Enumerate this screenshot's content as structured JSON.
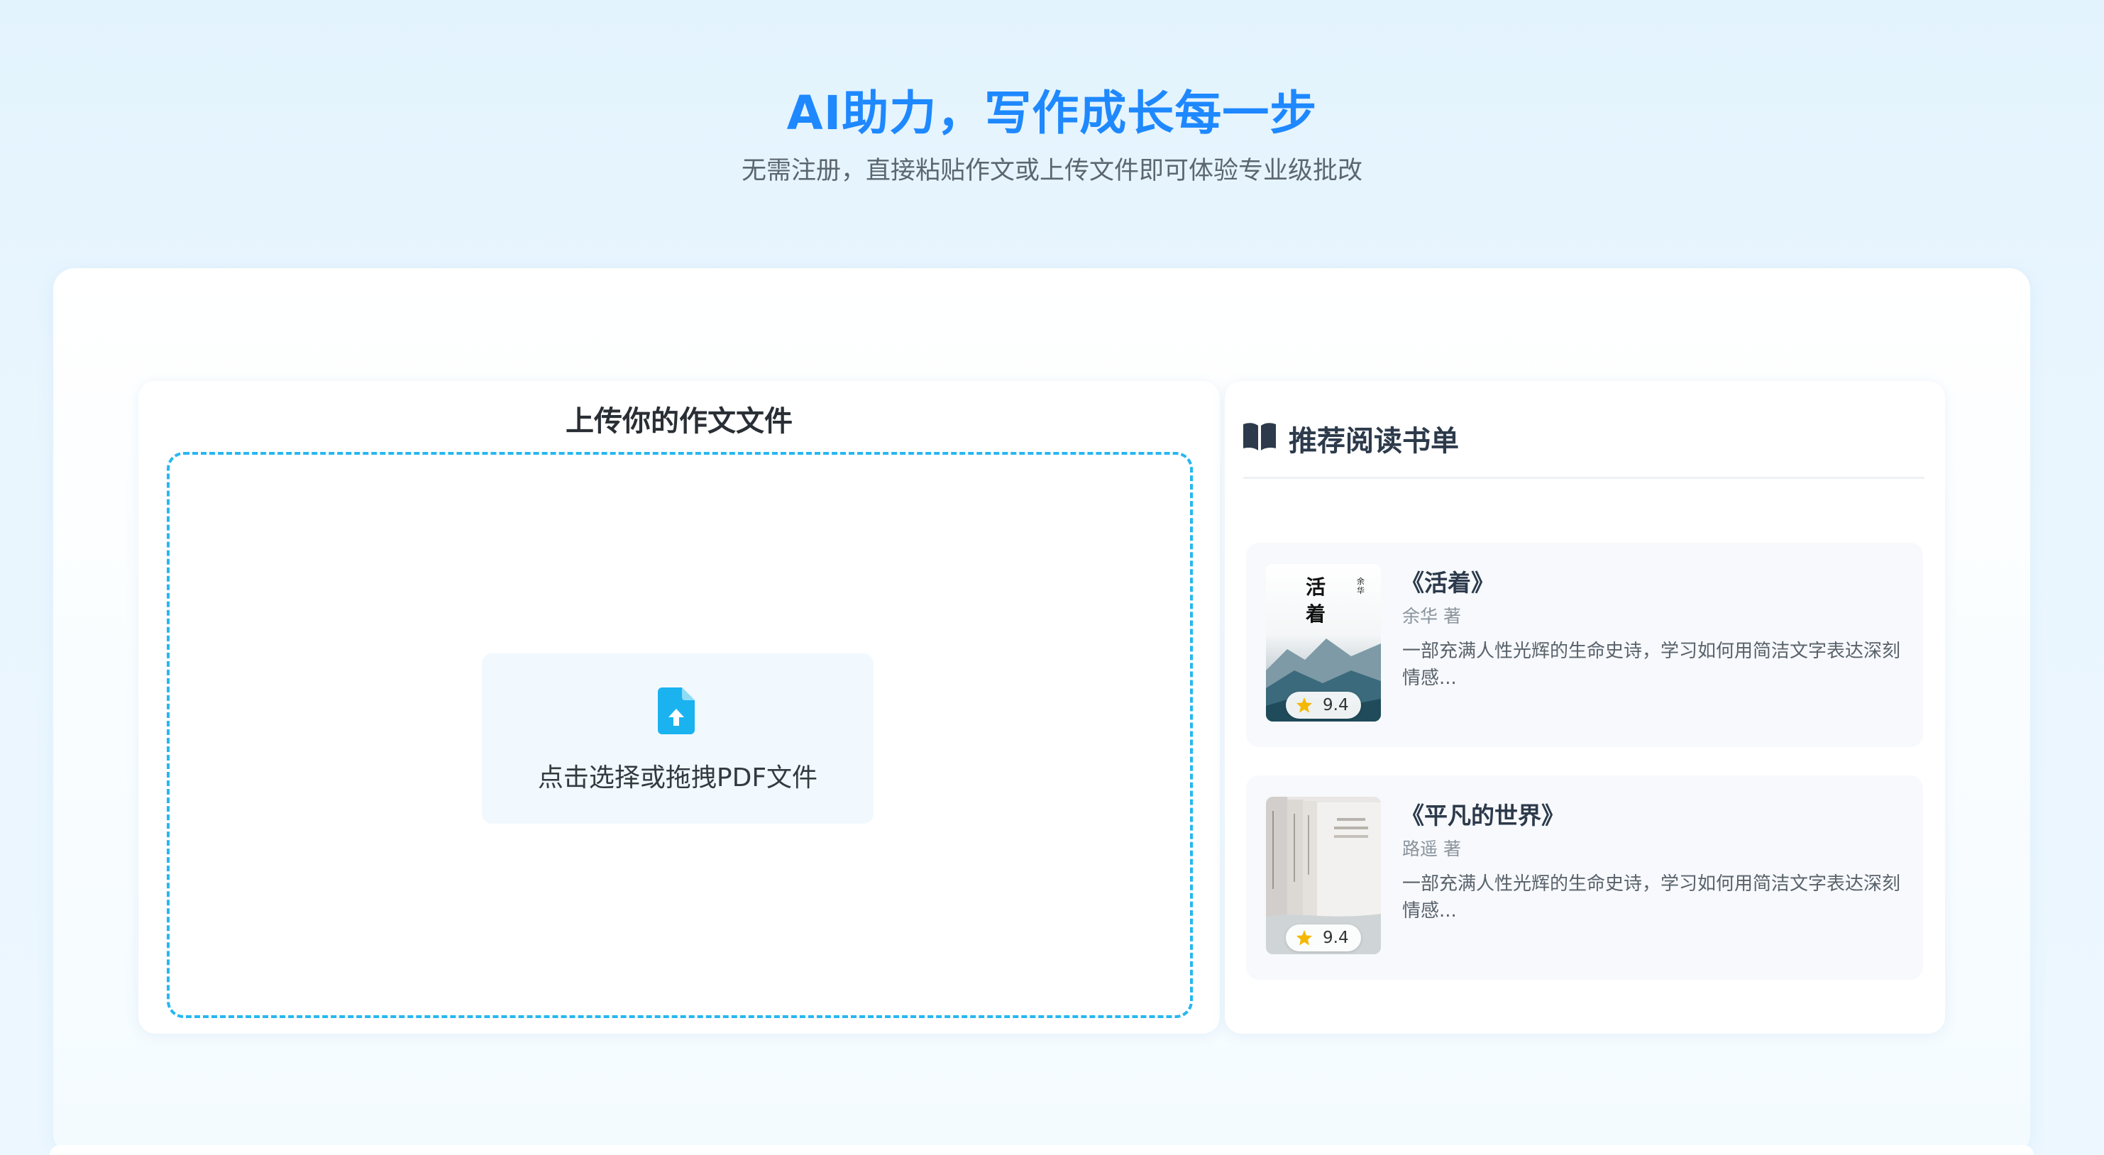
{
  "hero": {
    "title": "AI助力，写作成长每一步",
    "subtitle": "无需注册，直接粘贴作文或上传文件即可体验专业级批改"
  },
  "upload": {
    "title": "上传你的作文文件",
    "button_label": "点击选择或拖拽PDF文件",
    "icon": "file-upload-icon"
  },
  "books": {
    "title": "推荐阅读书单",
    "icon": "open-book-icon",
    "items": [
      {
        "title": "《活着》",
        "author": "余华 著",
        "description": "一部充满人性光辉的生命史诗，学习如何用简洁文字表达深刻情感...",
        "rating": "9.4",
        "cover_text": "活着",
        "cover_author": "余华"
      },
      {
        "title": "《平凡的世界》",
        "author": "路遥 著",
        "description": "一部充满人性光辉的生命史诗，学习如何用简洁文字表达深刻情感...",
        "rating": "9.4"
      }
    ]
  },
  "colors": {
    "accent": "#1e88ff",
    "dropzone_border": "#27b7f0",
    "upload_icon": "#1ab3f0",
    "star": "#f5b800"
  }
}
